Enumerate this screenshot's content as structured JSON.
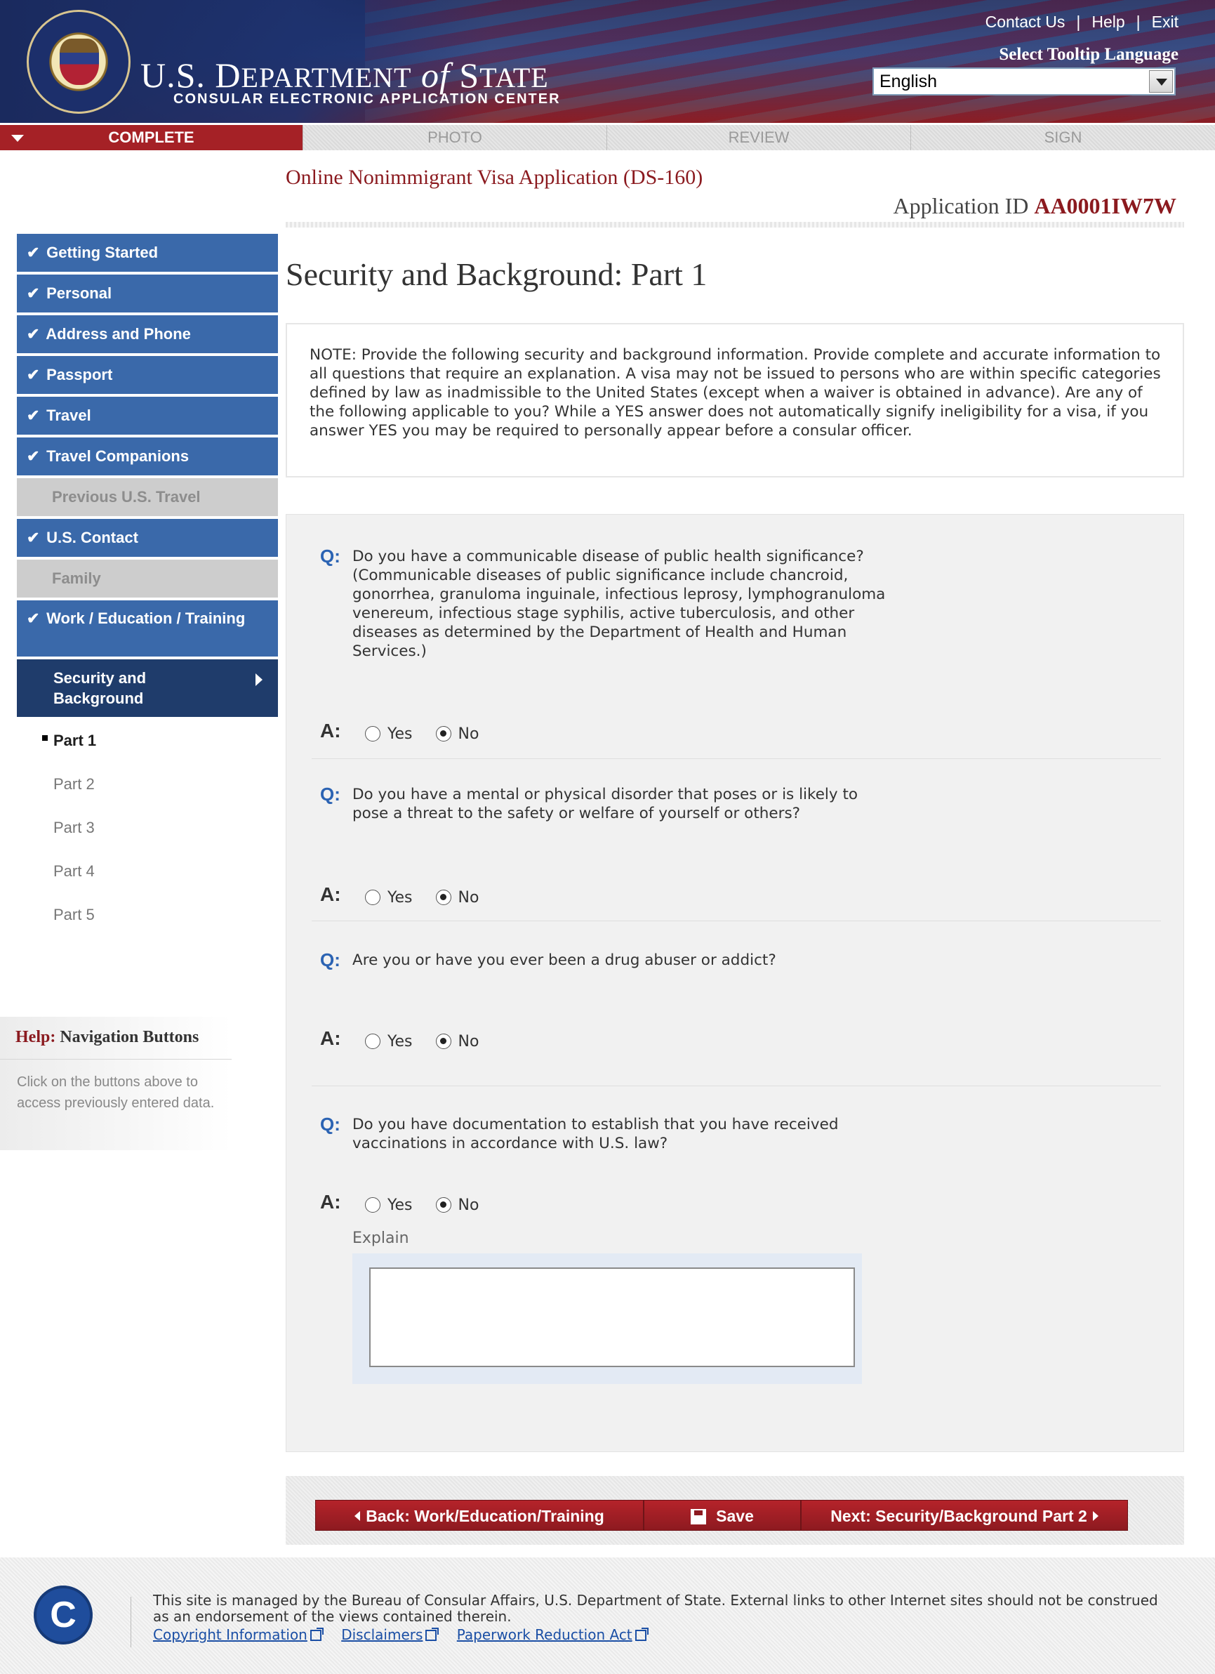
{
  "header": {
    "dept_prefix": "U.S. D",
    "dept_epartment": "EPARTMENT",
    "dept_of": "of",
    "dept_state": "S",
    "dept_tate": "TATE",
    "subtitle": "CONSULAR ELECTRONIC APPLICATION CENTER",
    "links": {
      "contact": "Contact Us",
      "help": "Help",
      "exit": "Exit"
    },
    "tooltip_label": "Select Tooltip Language",
    "language_value": "English"
  },
  "tabs": [
    {
      "label": "COMPLETE",
      "state": "active"
    },
    {
      "label": "PHOTO",
      "state": "inactive"
    },
    {
      "label": "REVIEW",
      "state": "inactive"
    },
    {
      "label": "SIGN",
      "state": "inactive"
    }
  ],
  "page": {
    "app_title": "Online Nonimmigrant Visa Application (DS-160)",
    "app_id_label": "Application ID ",
    "app_id_value": "AA0001IW7W",
    "section_title": "Security and Background: Part 1"
  },
  "sidebar": {
    "items": [
      {
        "label": "Getting Started",
        "check": "✔"
      },
      {
        "label": "Personal",
        "check": "✔"
      },
      {
        "label": "Address and Phone",
        "check": "✔"
      },
      {
        "label": "Passport",
        "check": "✔"
      },
      {
        "label": "Travel",
        "check": "✔"
      },
      {
        "label": "Travel Companions",
        "check": "✔"
      },
      {
        "label": "Previous U.S. Travel"
      },
      {
        "label": "U.S. Contact",
        "check": "✔"
      },
      {
        "label": "Family"
      },
      {
        "label": "Work / Education / Training",
        "check": "✔"
      },
      {
        "label": "Security and Background"
      }
    ],
    "subitems": [
      "Part 1",
      "Part 2",
      "Part 3",
      "Part 4",
      "Part 5"
    ]
  },
  "help": {
    "title_prefix": "Help:",
    "title_rest": " Navigation Buttons",
    "text": "Click on the buttons above to access previously entered data."
  },
  "note": "NOTE: Provide the following security and background information. Provide complete and accurate information to all questions that require an explanation. A visa may not be issued to persons who are within specific categories defined by law as inadmissible to the United States (except when a waiver is obtained in advance). Are any of the following applicable to you? While a YES answer does not automatically signify ineligibility for a visa, if you answer YES you may be required to personally appear before a consular officer.",
  "qa": {
    "q_mark": "Q:",
    "a_mark": "A:",
    "yes_label": "Yes",
    "no_label": "No",
    "questions": [
      {
        "text": "Do you have a communicable disease of public health significance? (Communicable diseases of public significance include chancroid, gonorrhea, granuloma inguinale, infectious leprosy, lymphogranuloma venereum, infectious stage syphilis, active tuberculosis, and other diseases as determined by the Department of Health and Human Services.)",
        "answer": "No"
      },
      {
        "text": "Do you have a mental or physical disorder that poses or is likely to pose a threat to the safety or welfare of yourself or others?",
        "answer": "No"
      },
      {
        "text": "Are you or have you ever been a drug abuser or addict?",
        "answer": "No"
      },
      {
        "text": "Do you have documentation to establish that you have received vaccinations in accordance with U.S. law?",
        "answer": "No"
      }
    ],
    "explain_label": "Explain",
    "explain_value": ""
  },
  "buttons": {
    "back": "Back: Work/Education/Training",
    "save": "Save",
    "next": "Next: Security/Background Part 2"
  },
  "footer": {
    "text": "This site is managed by the Bureau of Consular Affairs, U.S. Department of State. External links to other Internet sites should not be construed as an endorsement of the views contained therein.",
    "links": [
      "Copyright Information",
      "Disclaimers",
      "Paperwork Reduction Act"
    ],
    "logo_letter": "C"
  }
}
